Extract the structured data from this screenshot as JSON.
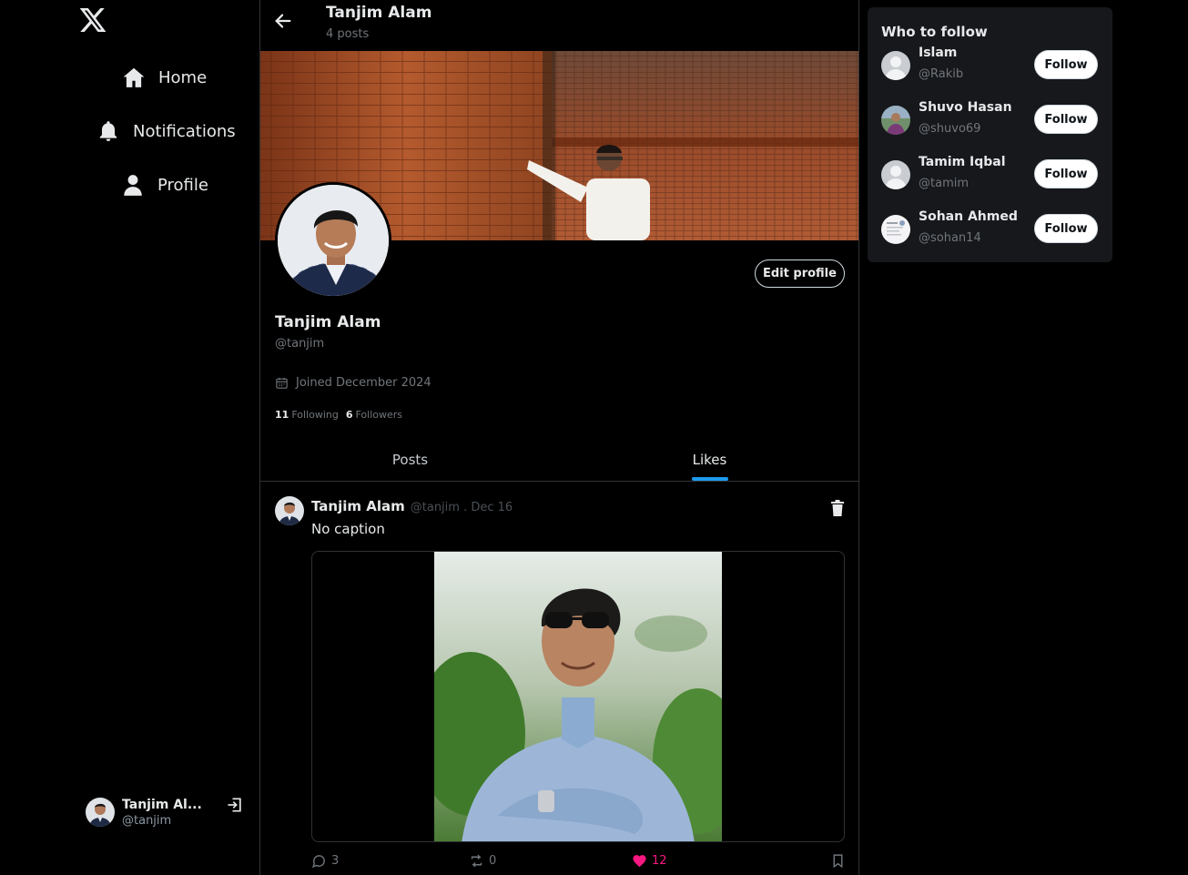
{
  "sidebar": {
    "logo": "x-logo",
    "nav": [
      {
        "label": "Home",
        "icon": "home-icon"
      },
      {
        "label": "Notifications",
        "icon": "bell-icon"
      },
      {
        "label": "Profile",
        "icon": "user-icon"
      }
    ],
    "account": {
      "name": "Tanjim Al...",
      "handle": "@tanjim",
      "logout_icon": "logout-icon"
    }
  },
  "header": {
    "title": "Tanjim Alam",
    "subtitle": "4 posts"
  },
  "profile": {
    "name": "Tanjim Alam",
    "handle": "@tanjim",
    "joined": "Joined December 2024",
    "following_count": "11",
    "following_label": "Following",
    "followers_count": "6",
    "followers_label": "Followers",
    "edit_label": "Edit profile"
  },
  "tabs": [
    {
      "label": "Posts",
      "active": false
    },
    {
      "label": "Likes",
      "active": true
    }
  ],
  "post": {
    "name": "Tanjim Alam",
    "meta": "@tanjim . Dec 16",
    "text": "No caption",
    "replies": "3",
    "retweets": "0",
    "likes": "12",
    "liked": true
  },
  "who_to_follow": {
    "title": "Who to follow",
    "button_label": "Follow",
    "users": [
      {
        "name": "Islam",
        "handle": "@Rakib"
      },
      {
        "name": "Shuvo Hasan",
        "handle": "@shuvo69"
      },
      {
        "name": "Tamim Iqbal",
        "handle": "@tamim"
      },
      {
        "name": "Sohan Ahmed",
        "handle": "@sohan14"
      }
    ]
  },
  "colors": {
    "accent": "#1d9bf0",
    "like": "#f91880",
    "background": "#000000",
    "panel": "#16181c"
  }
}
